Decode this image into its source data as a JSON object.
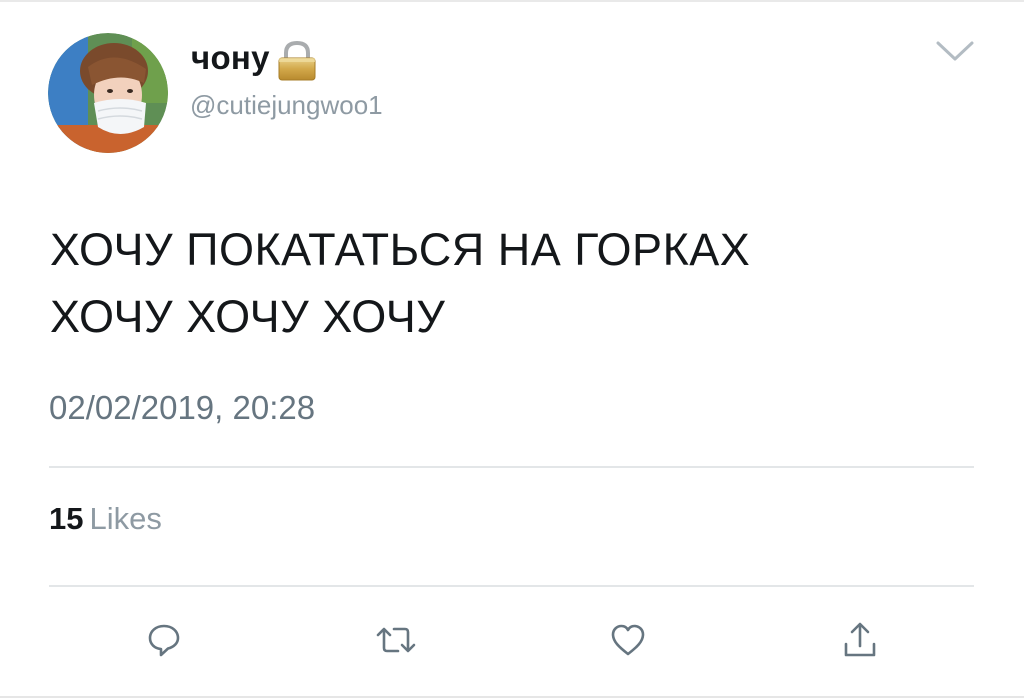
{
  "tweet": {
    "display_name": "чону",
    "handle": "@cutiejungwoo1",
    "text_lines": [
      "ХОЧУ ПОКАТАТЬСЯ НА ГОРКАХ",
      "ХОЧУ ХОЧУ ХОЧУ"
    ],
    "timestamp": "02/02/2019, 20:28",
    "likes_count": "15",
    "likes_label": "Likes",
    "protected_account": true
  },
  "actions": {
    "reply_icon": "speech-bubble",
    "retweet_icon": "retweet-arrows",
    "like_icon": "heart-outline",
    "share_icon": "share-arrow-up"
  },
  "colors": {
    "text_primary": "#14171a",
    "text_secondary": "#8e9aa3",
    "icon_gray": "#667580",
    "divider": "#e3e6e8"
  }
}
